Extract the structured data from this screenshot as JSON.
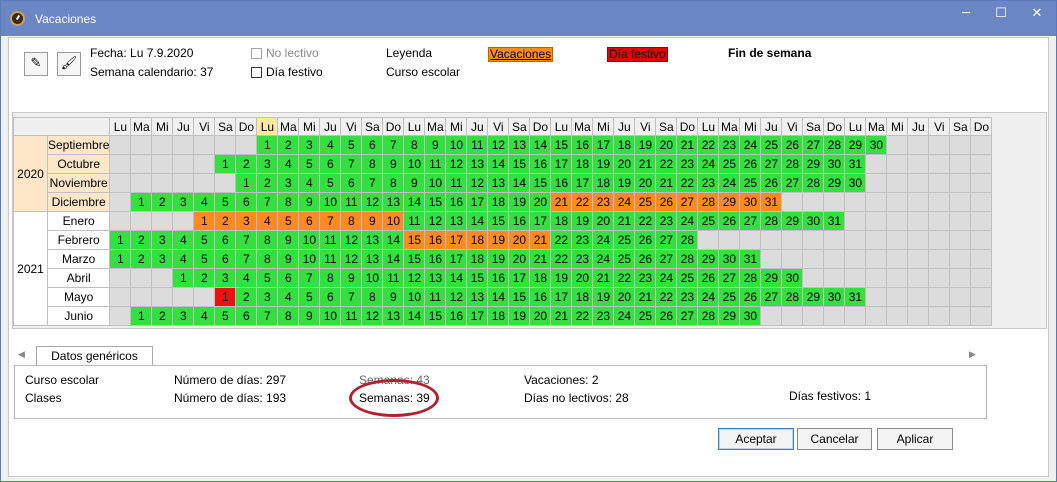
{
  "window": {
    "title": "Vacaciones",
    "minimize": "─",
    "maximize": "☐",
    "close": "✕"
  },
  "toolbar": {
    "edit_icon": "notepad-icon",
    "brush_icon": "brush-icon"
  },
  "info": {
    "fecha": "Fecha: Lu 7.9.2020",
    "semana": "Semana calendario: 37"
  },
  "checks": {
    "no_lectivo": "No lectivo",
    "dia_festivo": "Día festivo"
  },
  "legend": {
    "title": "Leyenda",
    "curso": "Curso escolar",
    "vacaciones": "Vacaciones",
    "festivo": "Día festivo",
    "fin_semana": "Fin de semana"
  },
  "calendar": {
    "weekdays": [
      "Lu",
      "Ma",
      "Mi",
      "Ju",
      "Vi",
      "Sa",
      "Do"
    ],
    "total_columns": 42,
    "today_column": 7,
    "years": [
      {
        "label": "2020",
        "months": 4
      },
      {
        "label": "2021",
        "months": 6
      }
    ],
    "months": [
      {
        "name": "Septiembre",
        "start": 7,
        "days": 30
      },
      {
        "name": "Octubre",
        "start": 5,
        "days": 31
      },
      {
        "name": "Noviembre",
        "start": 6,
        "days": 30
      },
      {
        "name": "Diciembre",
        "start": 1,
        "days": 31,
        "vacation": [
          21,
          31
        ]
      },
      {
        "name": "Enero",
        "start": 4,
        "days": 31,
        "vacation": [
          1,
          10
        ]
      },
      {
        "name": "Febrero",
        "start": 0,
        "days": 28,
        "vacation": [
          15,
          21
        ]
      },
      {
        "name": "Marzo",
        "start": 0,
        "days": 31
      },
      {
        "name": "Abril",
        "start": 3,
        "days": 30
      },
      {
        "name": "Mayo",
        "start": 5,
        "days": 31,
        "holiday": [
          1
        ]
      },
      {
        "name": "Junio",
        "start": 1,
        "days": 30
      }
    ],
    "school_start": [
      0,
      1
    ],
    "school_end": [
      9,
      30
    ]
  },
  "tabs": {
    "generic": "Datos genéricos"
  },
  "generic": {
    "row1_label": "Curso escolar",
    "row1_days": "Número de días: 297",
    "row1_weeks": "Semanas: 43",
    "row1_vac": "Vacaciones: 2",
    "row2_label": "Clases",
    "row2_days": "Número de días: 193",
    "row2_weeks": "Semanas: 39",
    "row2_nolect": "Días no lectivos: 28",
    "row2_fest": "Días festivos: 1"
  },
  "buttons": {
    "accept": "Aceptar",
    "cancel": "Cancelar",
    "apply": "Aplicar"
  },
  "colors": {
    "school": "#33e03f",
    "vacation": "#ff8a1f",
    "holiday": "#ee1111",
    "empty": "#dcdcdc",
    "title_bar": "#6b86c4",
    "annotation": "#b3202e"
  }
}
